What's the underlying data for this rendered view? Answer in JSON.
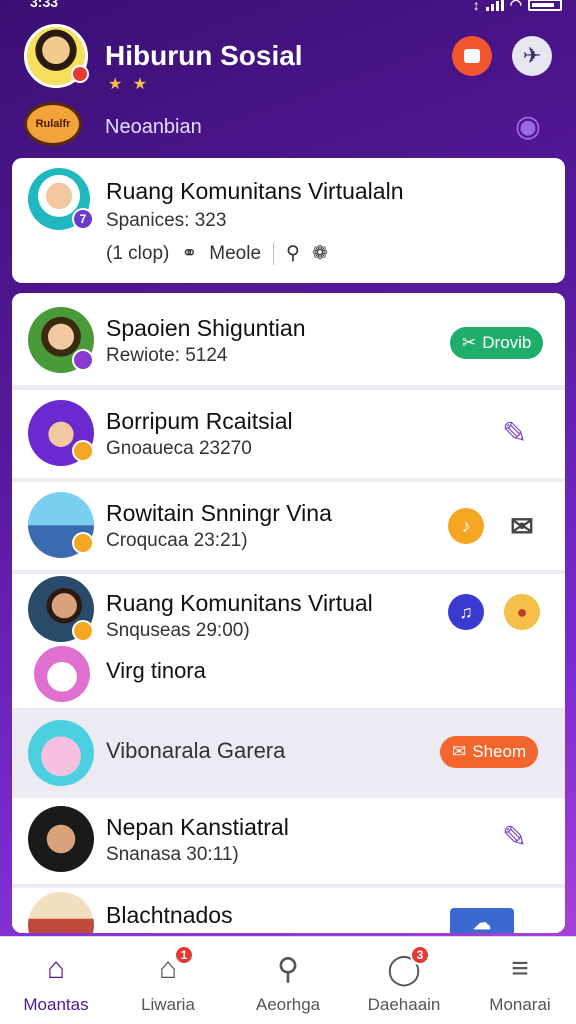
{
  "status": {
    "time": "3:33"
  },
  "header": {
    "title": "Hiburun Sosial",
    "stars": "★ ★",
    "logo_text": "Rulalfr",
    "subtitle": "Neoanbian"
  },
  "top_card": {
    "title": "Ruang Komunitans Virtualaln",
    "sub": "Spanices: 323",
    "meta_a": "(1 clop)",
    "meta_b": "Meole",
    "badge": "7"
  },
  "rows": [
    {
      "title": "Spaoien Shiguntian",
      "sub": "Rewiote: 5124",
      "action": "Drovib"
    },
    {
      "title": "Borripum Rcaitsial",
      "sub": "Gnoaueca 23270"
    },
    {
      "title": "Rowitain Snningr Vina",
      "sub": "Croqucaa 23:21)"
    },
    {
      "title": "Ruang Komunitans Virtual",
      "sub": "Snquseas 29:00)"
    },
    {
      "title": "Virg tinora"
    },
    {
      "title": "Vibonarala Garera",
      "action": "Sheom"
    },
    {
      "title": "Nepan Kanstiatral",
      "sub": "Snanasa 30:11)"
    },
    {
      "title": "Blachtnados"
    }
  ],
  "nav": [
    {
      "label": "Moantas",
      "icon": "home-icon"
    },
    {
      "label": "Liwaria",
      "icon": "house-icon",
      "badge": "1"
    },
    {
      "label": "Aeorhga",
      "icon": "search-icon"
    },
    {
      "label": "Daehaain",
      "icon": "chat-icon",
      "badge": "3"
    },
    {
      "label": "Monarai",
      "icon": "menu-icon"
    }
  ]
}
